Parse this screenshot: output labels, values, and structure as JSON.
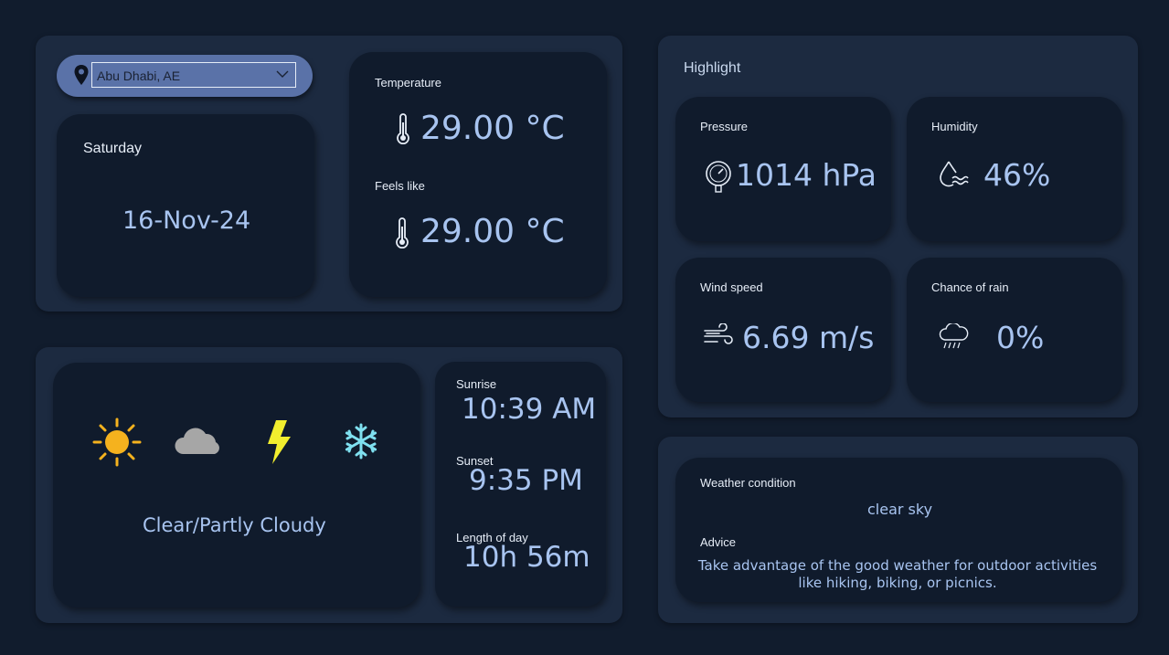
{
  "location": {
    "selected": "Abu Dhabi, AE",
    "pin_icon": "map-pin-icon",
    "dropdown_icon": "chevron-down-icon"
  },
  "date": {
    "day": "Saturday",
    "date": "16-Nov-24"
  },
  "temperature": {
    "label": "Temperature",
    "value": "29.00 °C",
    "feels_like_label": "Feels like",
    "feels_like_value": "29.00 °C"
  },
  "conditions_panel": {
    "icons": [
      "sun-icon",
      "cloud-icon",
      "lightning-icon",
      "snowflake-icon"
    ],
    "summary": "Clear/Partly Cloudy"
  },
  "sun": {
    "sunrise_label": "Sunrise",
    "sunrise": "10:39 AM",
    "sunset_label": "Sunset",
    "sunset": "9:35 PM",
    "day_length_label": "Length of day",
    "day_length": "10h 56m"
  },
  "highlight": {
    "title": "Highlight",
    "pressure_label": "Pressure",
    "pressure": "1014 hPa",
    "humidity_label": "Humidity",
    "humidity": "46%",
    "wind_label": "Wind speed",
    "wind": "6.69 m/s",
    "rain_label": "Chance of rain",
    "rain": "0%"
  },
  "weather": {
    "condition_label": "Weather condition",
    "condition": "clear sky",
    "advice_label": "Advice",
    "advice": "Take advantage of the good weather for outdoor activities like hiking, biking, or picnics."
  },
  "colors": {
    "background": "#111c2d",
    "panel": "#1c2a40",
    "card": "#101b2c",
    "accent_text": "#a8c4f0",
    "location_pill": "#5a72a8",
    "sun": "#f5b21e",
    "lightning": "#f2ee2e",
    "snowflake": "#7fe0f0",
    "cloud": "#a6a6a6"
  }
}
